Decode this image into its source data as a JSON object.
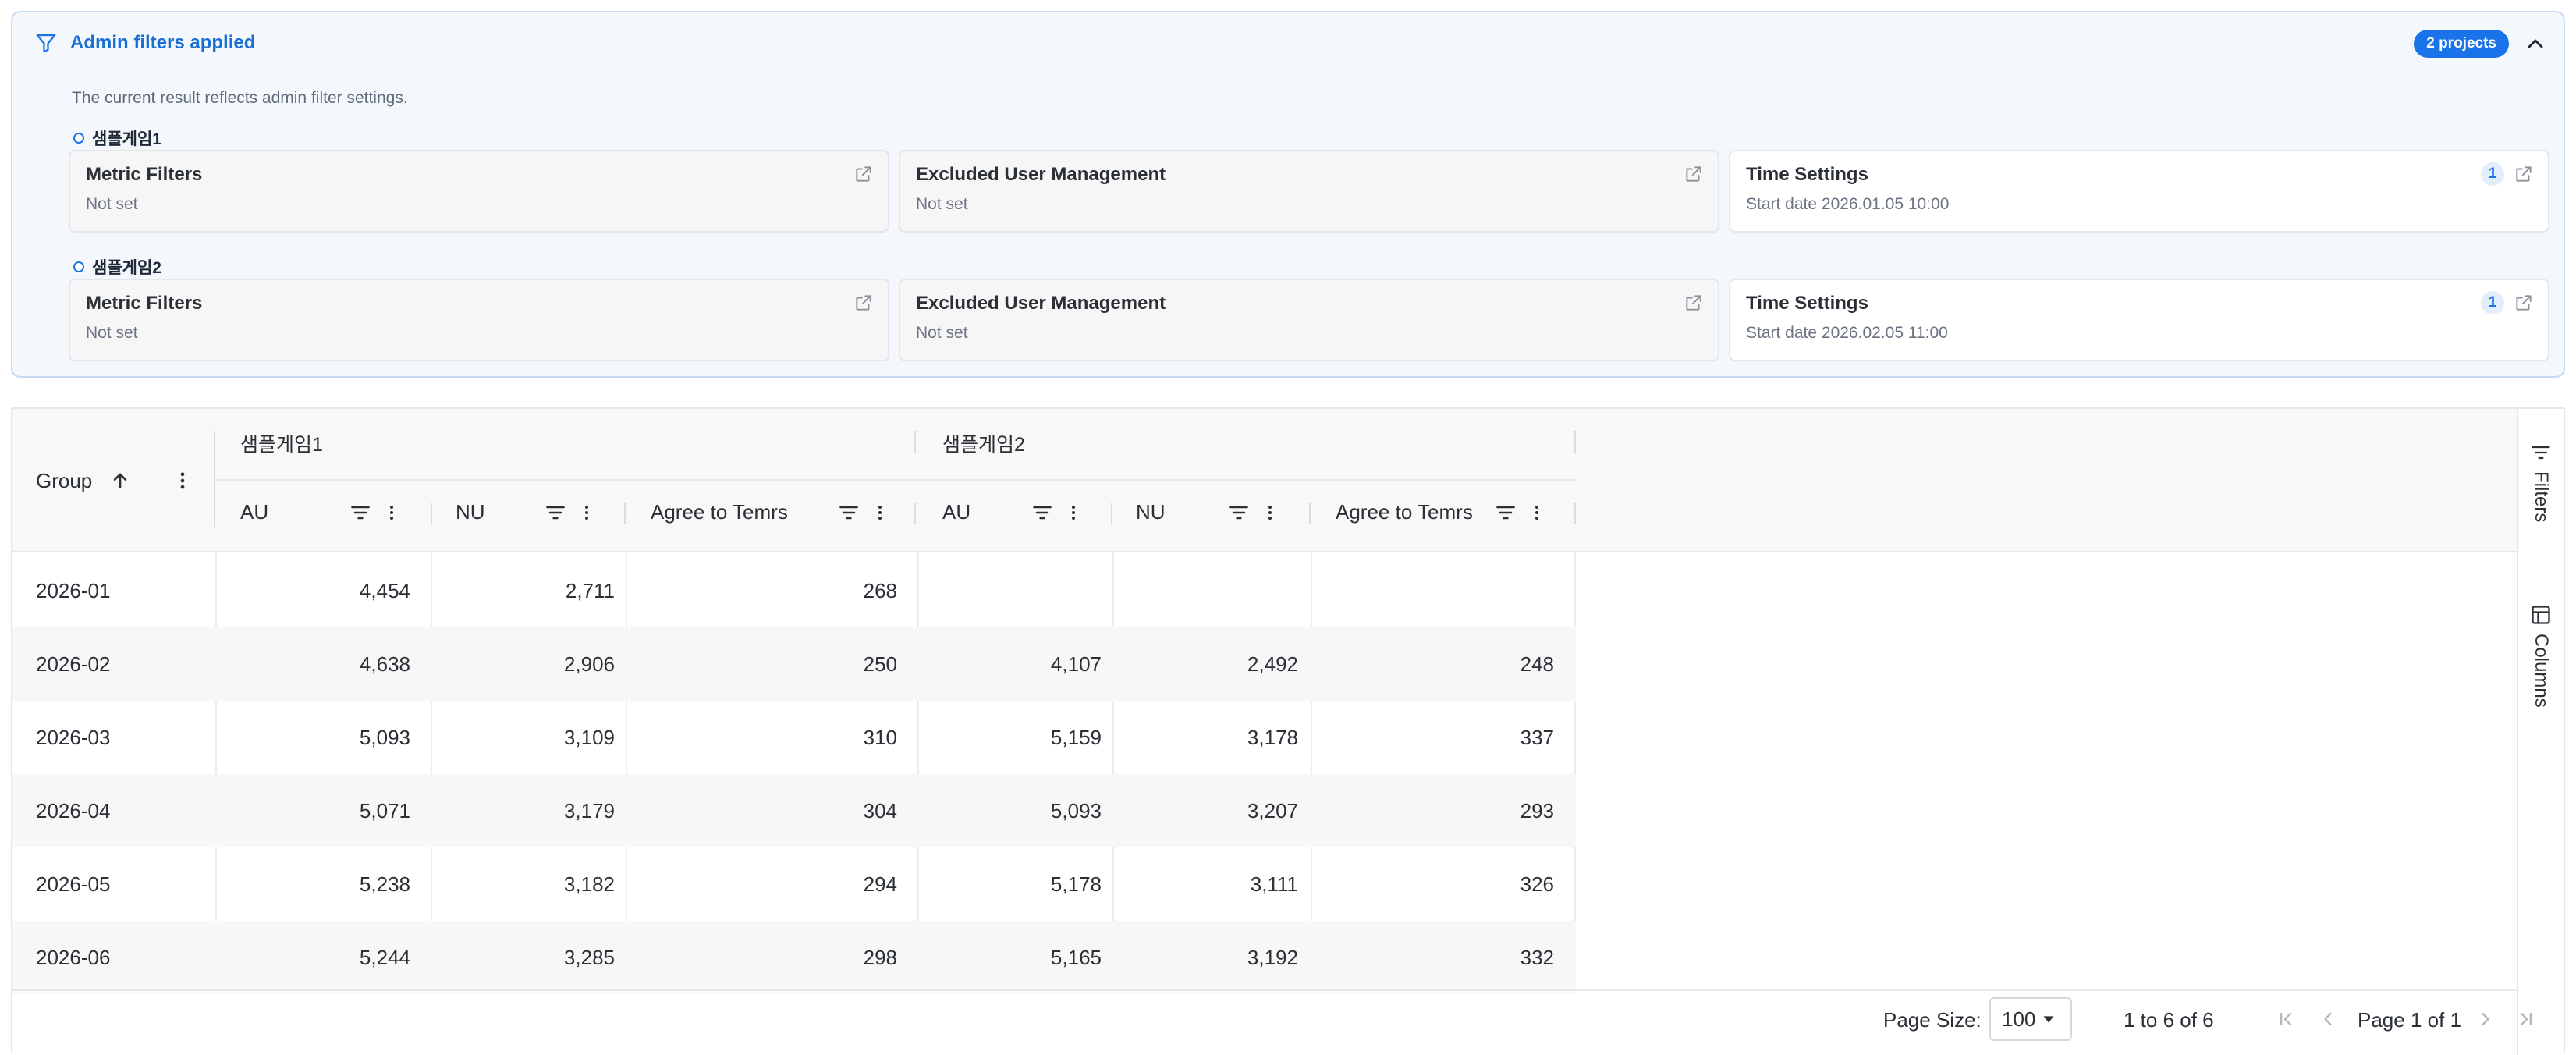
{
  "admin_panel": {
    "title": "Admin filters applied",
    "description": "The current result reflects admin filter settings.",
    "badge": "2 projects",
    "projects": [
      {
        "name": "샘플게임1",
        "cards": [
          {
            "title": "Metric Filters",
            "value": "Not set",
            "count": null
          },
          {
            "title": "Excluded User Management",
            "value": "Not set",
            "count": null
          },
          {
            "title": "Time Settings",
            "value": "Start date 2026.01.05 10:00",
            "count": "1"
          }
        ]
      },
      {
        "name": "샘플게임2",
        "cards": [
          {
            "title": "Metric Filters",
            "value": "Not set",
            "count": null
          },
          {
            "title": "Excluded User Management",
            "value": "Not set",
            "count": null
          },
          {
            "title": "Time Settings",
            "value": "Start date 2026.02.05 11:00",
            "count": "1"
          }
        ]
      }
    ]
  },
  "grid": {
    "group_header": "Group",
    "groups": [
      "샘플게임1",
      "샘플게임2"
    ],
    "columns": [
      "AU",
      "NU",
      "Agree to Temrs",
      "AU",
      "NU",
      "Agree to Temrs"
    ],
    "rows": [
      {
        "group": "2026-01",
        "values": [
          "4,454",
          "2,711",
          "268",
          "",
          "",
          ""
        ]
      },
      {
        "group": "2026-02",
        "values": [
          "4,638",
          "2,906",
          "250",
          "4,107",
          "2,492",
          "248"
        ]
      },
      {
        "group": "2026-03",
        "values": [
          "5,093",
          "3,109",
          "310",
          "5,159",
          "3,178",
          "337"
        ]
      },
      {
        "group": "2026-04",
        "values": [
          "5,071",
          "3,179",
          "304",
          "5,093",
          "3,207",
          "293"
        ]
      },
      {
        "group": "2026-05",
        "values": [
          "5,238",
          "3,182",
          "294",
          "5,178",
          "3,111",
          "326"
        ]
      },
      {
        "group": "2026-06",
        "values": [
          "5,244",
          "3,285",
          "298",
          "5,165",
          "3,192",
          "332"
        ]
      }
    ]
  },
  "side_panel": {
    "filters_label": "Filters",
    "columns_label": "Columns"
  },
  "pagination": {
    "page_size_label": "Page Size:",
    "page_size_value": "100",
    "range_text": "1 to 6 of 6",
    "page_text_prefix": "Page",
    "current_page": "1",
    "page_text_of": "of",
    "total_pages": "1"
  },
  "colors": {
    "accent": "#1a73e8",
    "panel_bg": "#f4f8fd",
    "panel_border": "#c7d9f2"
  }
}
